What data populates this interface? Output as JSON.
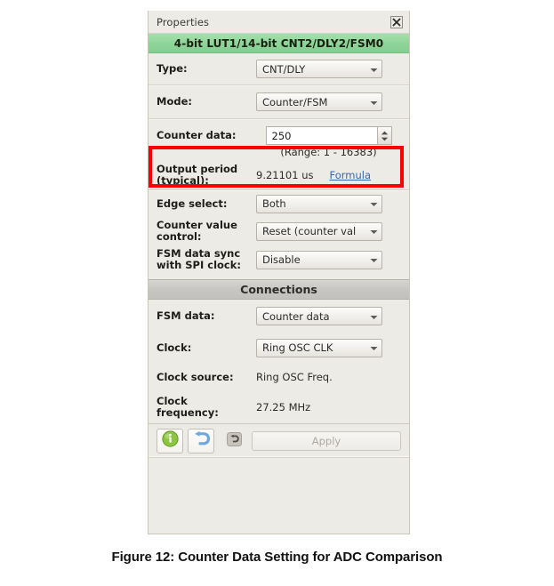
{
  "panel": {
    "titlebar": {
      "title": "Properties",
      "close_icon": "close-icon"
    },
    "component_header": "4-bit LUT1/14-bit CNT2/DLY2/FSM0",
    "sections": [
      {
        "name": "main",
        "rows": [
          {
            "label": "Type:",
            "control": "combo",
            "value": "CNT/DLY"
          },
          {
            "label": "Mode:",
            "control": "combo",
            "value": "Counter/FSM"
          },
          {
            "label": "Counter data:",
            "control": "spinner",
            "value": "250",
            "hint": "(Range:  1 - 16383)"
          },
          {
            "label": "Output period (typical):",
            "control": "text",
            "value": "9.21101 us",
            "link": "Formula"
          },
          {
            "label": "Edge select:",
            "control": "combo",
            "value": "Both"
          },
          {
            "label": "Counter value control:",
            "control": "combo",
            "value": "Reset (counter val"
          },
          {
            "label": "FSM data sync with SPI clock:",
            "control": "combo",
            "value": "Disable"
          }
        ]
      },
      {
        "name": "connections",
        "header": "Connections",
        "rows": [
          {
            "label": "FSM data:",
            "control": "combo",
            "value": "Counter data"
          },
          {
            "label": "Clock:",
            "control": "combo",
            "value": "Ring OSC CLK"
          },
          {
            "label": "Clock source:",
            "control": "text",
            "value": "Ring OSC Freq."
          },
          {
            "label": "Clock frequency:",
            "control": "text",
            "value": "27.25 MHz"
          }
        ]
      }
    ],
    "footer": {
      "info_icon": "info-icon",
      "undo_icon": "undo-icon",
      "revert_icon": "revert-icon",
      "apply_label": "Apply"
    }
  },
  "annotation": {
    "highlight_color": "#fb0000",
    "highlight_target": "Counter data"
  },
  "caption": "Figure 12: Counter Data Setting for ADC Comparison",
  "colors": {
    "header_green": "#8ed49a",
    "panel_background": "#edebe6",
    "link_blue": "#3767b5",
    "annotation_red": "#fb0000"
  }
}
